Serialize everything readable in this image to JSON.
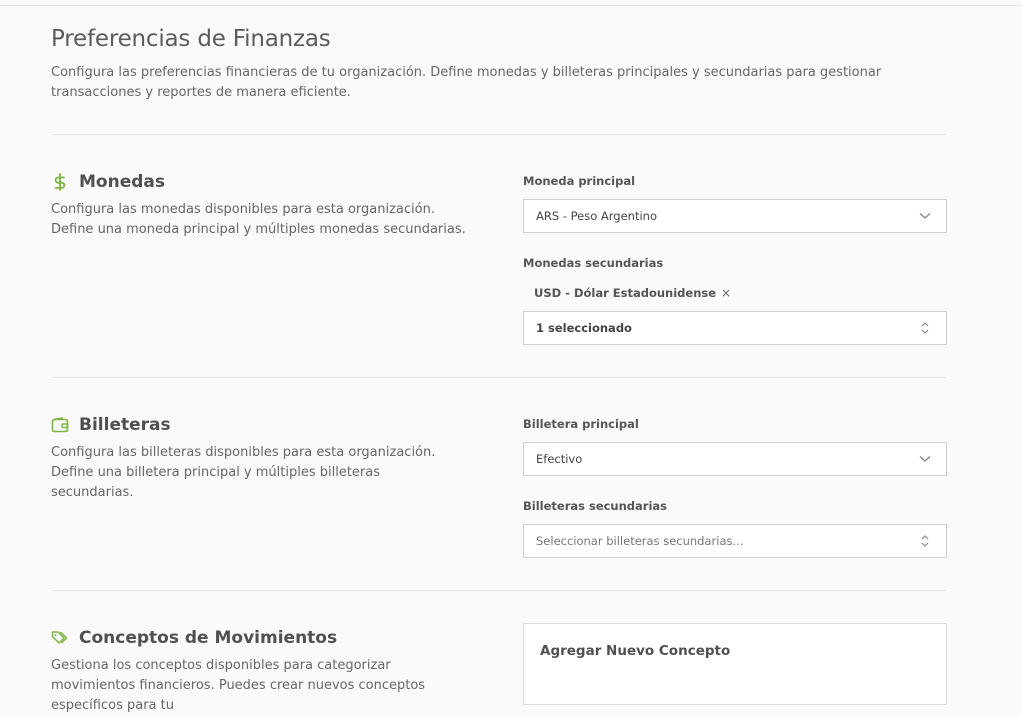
{
  "header": {
    "title": "Preferencias de Finanzas",
    "description": "Configura las preferencias financieras de tu organización. Define monedas y billeteras principales y secundarias para gestionar transacciones y reportes de manera eficiente."
  },
  "monedas": {
    "title": "Monedas",
    "icon": "dollar-icon",
    "description": "Configura las monedas disponibles para esta organización. Define una moneda principal y múltiples monedas secundarias.",
    "primary_label": "Moneda principal",
    "primary_value": "ARS - Peso Argentino",
    "secondary_label": "Monedas secundarias",
    "chips": [
      "USD - Dólar Estadounidense"
    ],
    "secondary_value": "1 seleccionado"
  },
  "billeteras": {
    "title": "Billeteras",
    "icon": "wallet-icon",
    "description": "Configura las billeteras disponibles para esta organización. Define una billetera principal y múltiples billeteras secundarias.",
    "primary_label": "Billetera principal",
    "primary_value": "Efectivo",
    "secondary_label": "Billeteras secundarias",
    "secondary_placeholder": "Seleccionar billeteras secundarias..."
  },
  "conceptos": {
    "title": "Conceptos de Movimientos",
    "icon": "tags-icon",
    "description": "Gestiona los conceptos disponibles para categorizar movimientos financieros. Puedes crear nuevos conceptos específicos para tu",
    "card_title": "Agregar Nuevo Concepto"
  },
  "colors": {
    "accent": "#7cb342",
    "border": "#cfcfcf",
    "background": "#fafafa"
  }
}
